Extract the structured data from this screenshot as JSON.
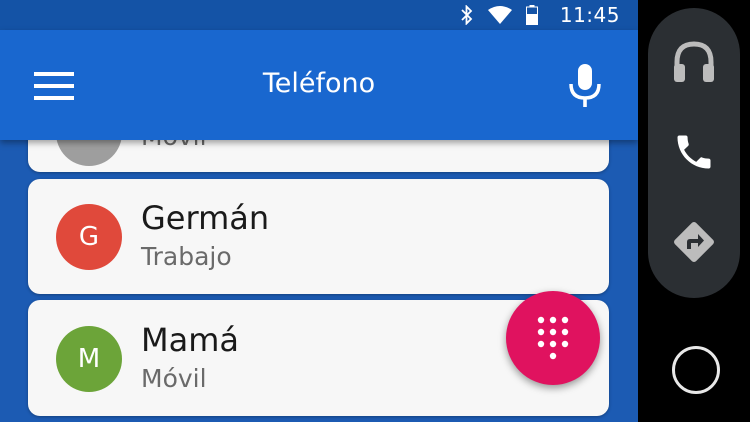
{
  "status_bar": {
    "time": "11:45",
    "icons": [
      "bluetooth-icon",
      "wifi-icon",
      "battery-icon"
    ]
  },
  "app_bar": {
    "title": "Teléfono",
    "menu_icon": "menu-icon",
    "mic_icon": "microphone-icon"
  },
  "contacts": [
    {
      "name": "",
      "type": "Móvil",
      "initial": "",
      "color": "#9e9e9e"
    },
    {
      "name": "Germán",
      "type": "Trabajo",
      "initial": "G",
      "color": "#e0493b"
    },
    {
      "name": "Mamá",
      "type": "Móvil",
      "initial": "M",
      "color": "#6ca439"
    }
  ],
  "fab": {
    "icon": "dialpad-icon",
    "color": "#e0125f"
  },
  "side_rail": {
    "items": [
      "headphones-icon",
      "phone-icon",
      "navigation-icon"
    ],
    "home_icon": "home-circle-icon"
  },
  "colors": {
    "primary": "#1967cf",
    "status_bar": "#1453a6",
    "accent": "#e0125f"
  }
}
